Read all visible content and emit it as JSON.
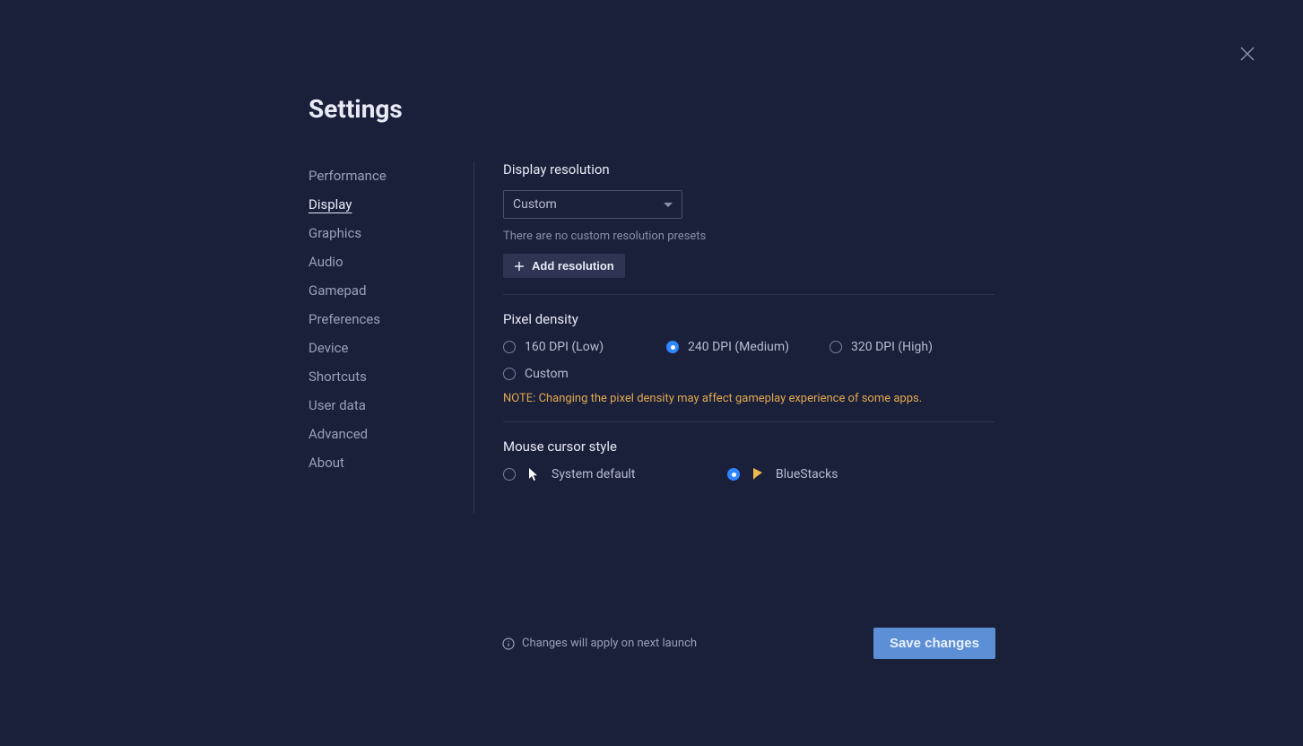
{
  "page_title": "Settings",
  "sidebar": {
    "items": [
      {
        "label": "Performance",
        "active": false
      },
      {
        "label": "Display",
        "active": true
      },
      {
        "label": "Graphics",
        "active": false
      },
      {
        "label": "Audio",
        "active": false
      },
      {
        "label": "Gamepad",
        "active": false
      },
      {
        "label": "Preferences",
        "active": false
      },
      {
        "label": "Device",
        "active": false
      },
      {
        "label": "Shortcuts",
        "active": false
      },
      {
        "label": "User data",
        "active": false
      },
      {
        "label": "Advanced",
        "active": false
      },
      {
        "label": "About",
        "active": false
      }
    ]
  },
  "display_resolution": {
    "title": "Display resolution",
    "selected": "Custom",
    "helper": "There are no custom resolution presets",
    "add_button": "Add resolution"
  },
  "pixel_density": {
    "title": "Pixel density",
    "options": [
      {
        "label": "160 DPI (Low)",
        "checked": false
      },
      {
        "label": "240 DPI (Medium)",
        "checked": true
      },
      {
        "label": "320 DPI (High)",
        "checked": false
      },
      {
        "label": "Custom",
        "checked": false
      }
    ],
    "note": "NOTE: Changing the pixel density may affect gameplay experience of some apps."
  },
  "cursor_style": {
    "title": "Mouse cursor style",
    "options": [
      {
        "label": "System default",
        "checked": false
      },
      {
        "label": "BlueStacks",
        "checked": true
      }
    ]
  },
  "footer": {
    "info": "Changes will apply on next launch",
    "save": "Save changes"
  }
}
